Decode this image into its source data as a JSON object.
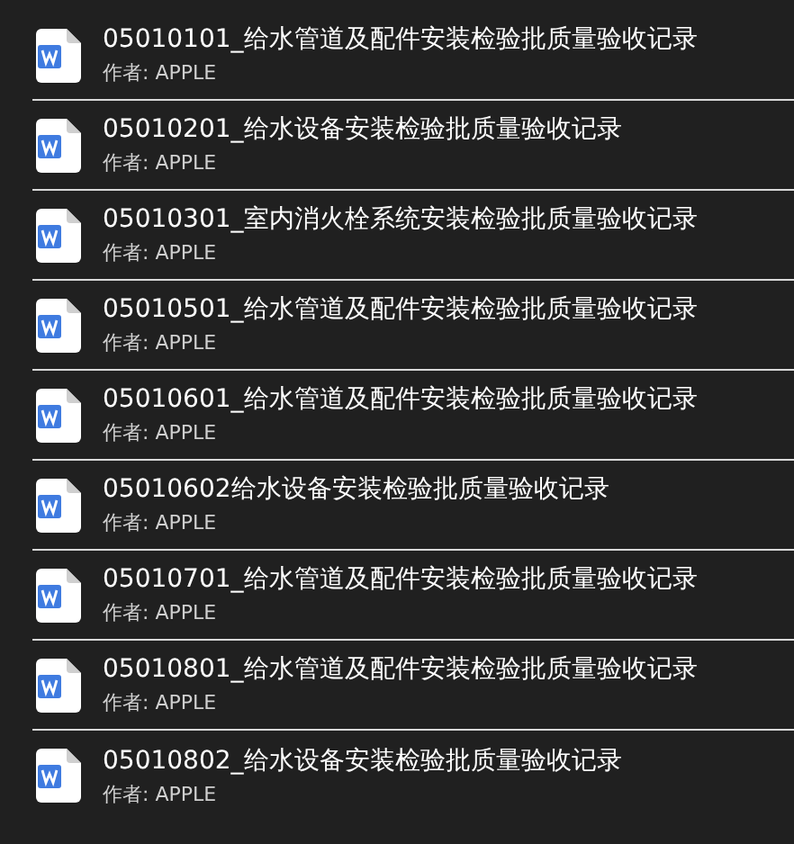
{
  "files": [
    {
      "title": "05010101_给水管道及配件安装检验批质量验收记录",
      "author": "作者: APPLE"
    },
    {
      "title": "05010201_给水设备安装检验批质量验收记录",
      "author": "作者: APPLE"
    },
    {
      "title": "05010301_室内消火栓系统安装检验批质量验收记录",
      "author": "作者: APPLE"
    },
    {
      "title": "05010501_给水管道及配件安装检验批质量验收记录",
      "author": "作者: APPLE"
    },
    {
      "title": "05010601_给水管道及配件安装检验批质量验收记录",
      "author": "作者: APPLE"
    },
    {
      "title": "05010602给水设备安装检验批质量验收记录",
      "author": "作者: APPLE"
    },
    {
      "title": "05010701_给水管道及配件安装检验批质量验收记录",
      "author": "作者: APPLE"
    },
    {
      "title": "05010801_给水管道及配件安装检验批质量验收记录",
      "author": "作者: APPLE"
    },
    {
      "title": "05010802_给水设备安装检验批质量验收记录",
      "author": "作者: APPLE"
    }
  ]
}
